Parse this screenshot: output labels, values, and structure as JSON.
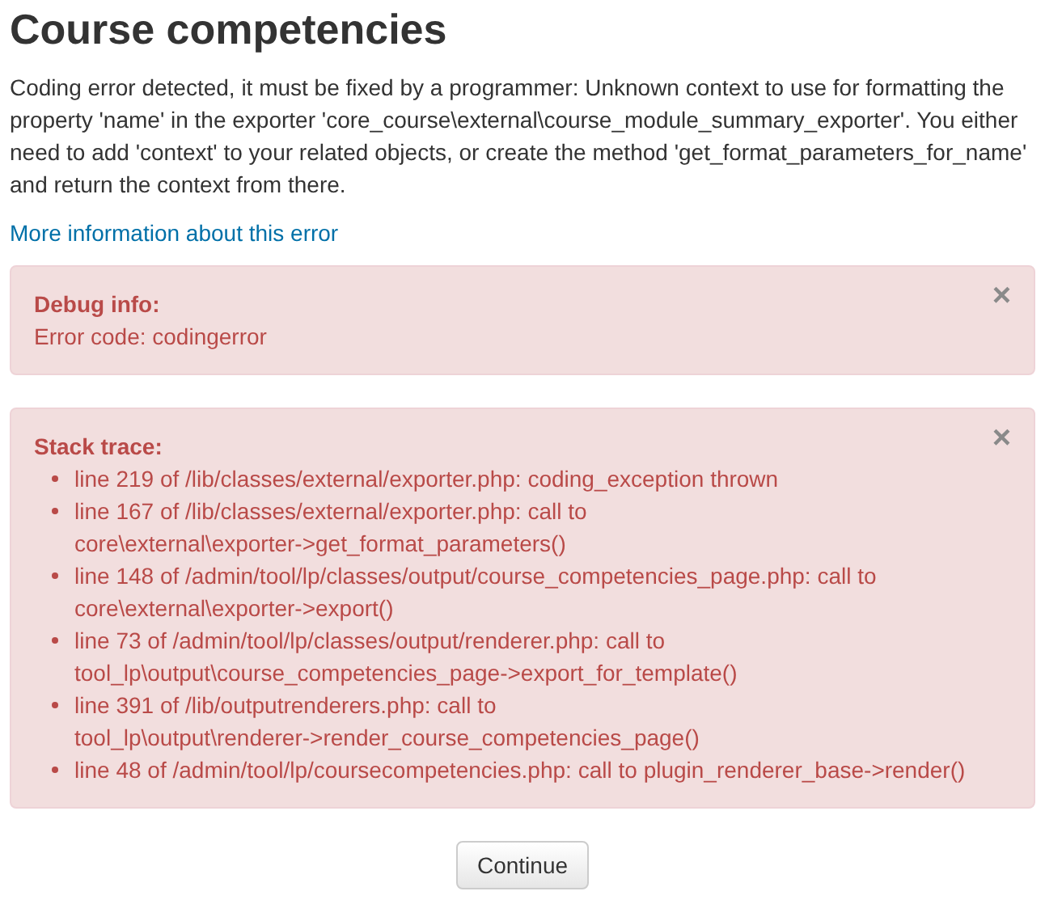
{
  "title": "Course competencies",
  "message": "Coding error detected, it must be fixed by a programmer: Unknown context to use for formatting the property 'name' in the exporter 'core_course\\external\\course_module_summary_exporter'. You either need to add 'context' to your related objects, or create the method 'get_format_parameters_for_name' and return the context from there.",
  "more_info_link": "More information about this error",
  "alerts": [
    {
      "kind": "text",
      "heading": "Debug info:",
      "close": "×",
      "body": "Error code: codingerror"
    },
    {
      "kind": "list",
      "heading": "Stack trace:",
      "close": "×",
      "items": [
        "line 219 of /lib/classes/external/exporter.php: coding_exception thrown",
        "line 167 of /lib/classes/external/exporter.php: call to core\\external\\exporter->get_format_parameters()",
        "line 148 of /admin/tool/lp/classes/output/course_competencies_page.php: call to core\\external\\exporter->export()",
        "line 73 of /admin/tool/lp/classes/output/renderer.php: call to tool_lp\\output\\course_competencies_page->export_for_template()",
        "line 391 of /lib/outputrenderers.php: call to tool_lp\\output\\renderer->render_course_competencies_page()",
        "line 48 of /admin/tool/lp/coursecompetencies.php: call to plugin_renderer_base->render()"
      ]
    }
  ],
  "continue_button": "Continue"
}
